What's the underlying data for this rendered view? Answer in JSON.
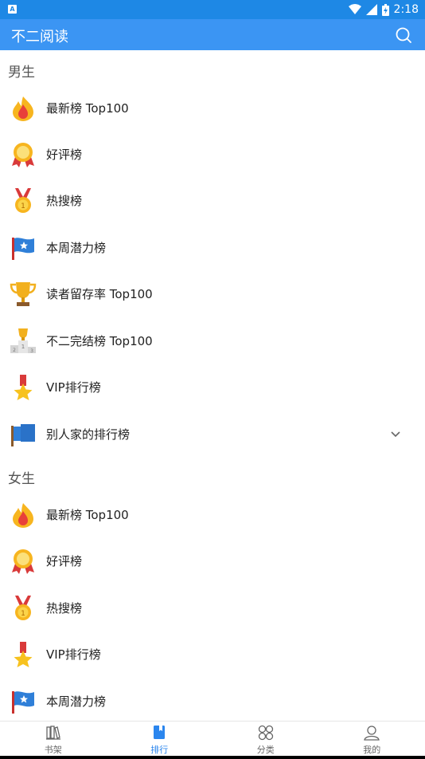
{
  "status": {
    "time": "2:18",
    "app_badge": "A"
  },
  "appbar": {
    "title": "不二阅读"
  },
  "male": {
    "header": "男生",
    "items": [
      {
        "label": "最新榜 Top100",
        "icon": "fire-icon"
      },
      {
        "label": "好评榜",
        "icon": "medal-badge-icon"
      },
      {
        "label": "热搜榜",
        "icon": "gold-medal-icon"
      },
      {
        "label": "本周潜力榜",
        "icon": "flag-icon"
      },
      {
        "label": "读者留存率 Top100",
        "icon": "trophy-icon"
      },
      {
        "label": "不二完结榜 Top100",
        "icon": "podium-icon"
      },
      {
        "label": "VIP排行榜",
        "icon": "star-medal-icon"
      },
      {
        "label": "别人家的排行榜",
        "icon": "flags-icon"
      }
    ]
  },
  "female": {
    "header": "女生",
    "items": [
      {
        "label": "最新榜 Top100",
        "icon": "fire-icon"
      },
      {
        "label": "好评榜",
        "icon": "medal-badge-icon"
      },
      {
        "label": "热搜榜",
        "icon": "gold-medal-icon"
      },
      {
        "label": "VIP排行榜",
        "icon": "star-medal-icon"
      },
      {
        "label": "本周潜力榜",
        "icon": "flag-icon"
      }
    ]
  },
  "bottom_nav": {
    "tabs": [
      {
        "label": "书架",
        "icon": "bookshelf-icon"
      },
      {
        "label": "排行",
        "icon": "book-icon",
        "active": true
      },
      {
        "label": "分类",
        "icon": "category-icon"
      },
      {
        "label": "我的",
        "icon": "profile-icon"
      }
    ]
  },
  "colors": {
    "status_bar": "#1e88e5",
    "app_bar": "#3b95f3",
    "active_tab": "#2b86ee"
  }
}
